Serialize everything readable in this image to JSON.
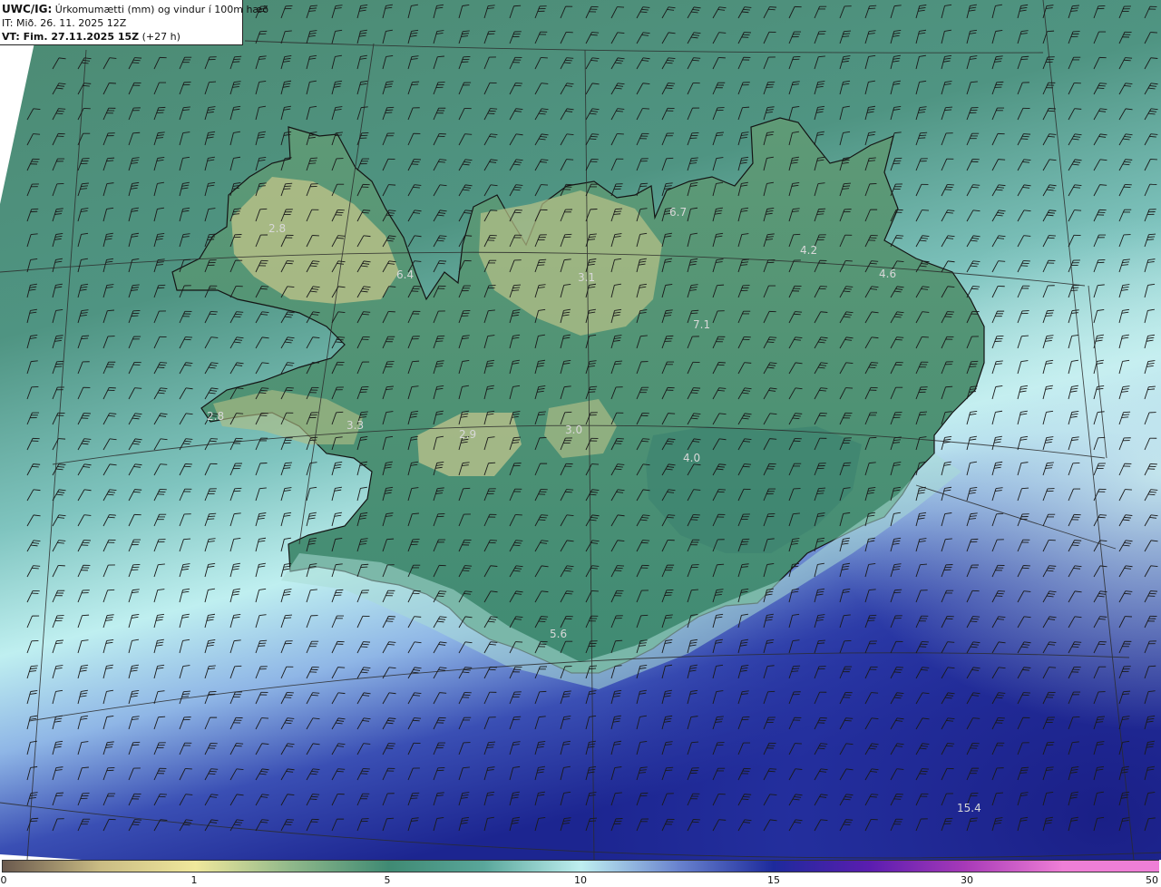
{
  "header": {
    "product": "UWC/IG:",
    "title": "Úrkomumætti (mm) og vindur í 100m hæð",
    "issue_time": "IT: Mið. 26. 11. 2025 12Z",
    "valid_prefix": "VT: Fim. 27.11.2025 15Z",
    "valid_suffix": "(+27 h)"
  },
  "map_values": [
    "2.8",
    "6.4",
    "6.7",
    "3.1",
    "7.1",
    "4.2",
    "4.6",
    "2.8",
    "3.3",
    "2.9",
    "3.0",
    "4.0",
    "5.6",
    "15.4"
  ],
  "colorbar": {
    "labels": [
      "0",
      "1",
      "5",
      "10",
      "15",
      "30",
      "50"
    ],
    "colors": [
      "#6b5a4e",
      "#c9bb83",
      "#f0e89c",
      "#8fb88a",
      "#3f8a73",
      "#5aa79b",
      "#bfeff0",
      "#6a84cf",
      "#1d2a9c",
      "#5b1db0",
      "#a83ab8",
      "#ef7fd6"
    ]
  },
  "colors": {
    "ocean_deep": "#1f2a8c",
    "ocean_light": "#bff0f2",
    "land_green": "#4f8e76",
    "land_high": "#c6c98c",
    "coastline": "#141414",
    "grid": "#2b2b2b",
    "barb": "#1a1a1a"
  }
}
